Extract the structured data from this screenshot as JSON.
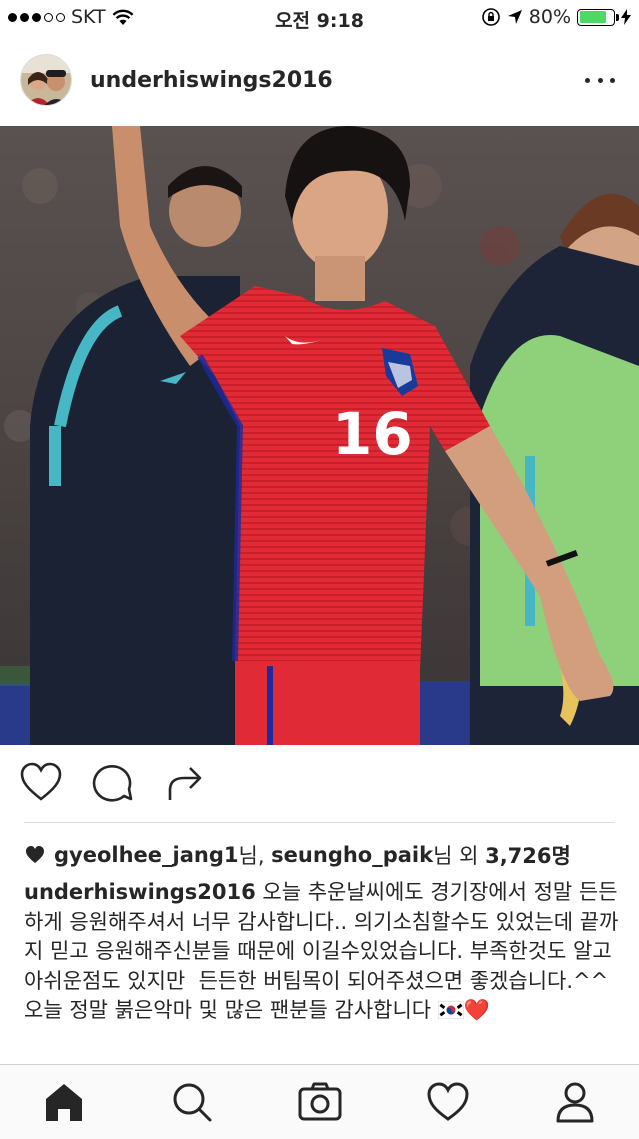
{
  "status_bar": {
    "carrier": "SKT",
    "time": "오전 9:18",
    "battery": "80%",
    "battery_level": 0.8
  },
  "post": {
    "username": "underhiswings2016",
    "likes": {
      "user1": "gyeolhee_jang1",
      "suffix1": "님, ",
      "user2": "seungho_paik",
      "suffix2": "님 외 ",
      "count": "3,726명"
    },
    "caption": {
      "username": "underhiswings2016",
      "text": " 오늘 추운날씨에도 경기장에서 정말 든든하게 응원해주셔서 너무 감사합니다.. 의기소침할수도 있었는데 끝까지 믿고 응원해주신분들 때문에 이길수있었습니다. 부족한것도 알고 아쉬운점도 있지만  든든한 버팀목이 되어주셨으면 좋겠습니다.^^ 오늘 정말 붉은악마 및 많은 팬분들 감사합니다",
      "emoji": "❤️"
    },
    "jersey_number": "16"
  },
  "icons": {
    "like": "heart-icon",
    "comment": "comment-icon",
    "share": "share-icon",
    "home": "home-icon",
    "search": "search-icon",
    "camera": "camera-icon",
    "activity": "heart-icon",
    "profile": "profile-icon"
  },
  "colors": {
    "battery_fill": "#4cd964",
    "heart_red": "#e0242f",
    "jersey_red": "#e02a35"
  }
}
